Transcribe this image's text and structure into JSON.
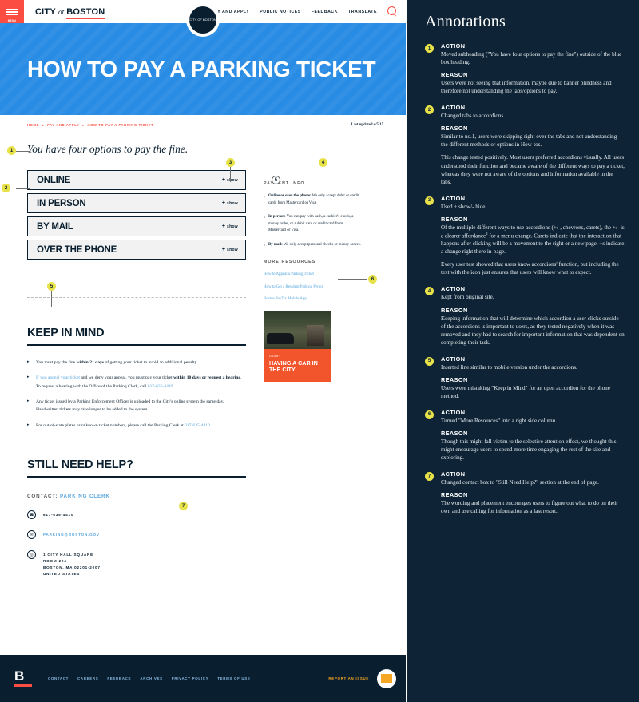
{
  "site": {
    "topbar": {
      "menu_label": "MENU",
      "logo_city": "CITY",
      "logo_of": "of",
      "logo_boston": "BOSTON",
      "seal_text": "CITY OF BOSTON",
      "nav": [
        "PAY AND APPLY",
        "PUBLIC NOTICES",
        "FEEDBACK",
        "TRANSLATE"
      ],
      "search_icon": "search-icon"
    },
    "hero_title": "HOW TO PAY A PARKING TICKET",
    "breadcrumbs": [
      "HOME",
      "PAY AND APPLY",
      "HOW TO PAY A PARKING TICKET"
    ],
    "breadcrumb_sep": "▸",
    "last_updated": "Last updated 4/5/15",
    "lede": "You have four options to pay the fine.",
    "accordions": [
      {
        "title": "ONLINE",
        "toggle": "show",
        "toggle_sign": "+"
      },
      {
        "title": "IN PERSON",
        "toggle": "show",
        "toggle_sign": "+"
      },
      {
        "title": "BY MAIL",
        "toggle": "show",
        "toggle_sign": "+"
      },
      {
        "title": "OVER THE PHONE",
        "toggle": "show",
        "toggle_sign": "+"
      }
    ],
    "payment_info": {
      "title": "PAYMENT INFO",
      "items": [
        {
          "lead": "Online or over the phone:",
          "text": " We only accept debit or credit cards from Mastercard or Visa."
        },
        {
          "lead": "In person:",
          "text": " You can pay with cash, a cashier's check, a money order, or a debit card or credit card from Mastercard or Visa."
        },
        {
          "lead": "By mail:",
          "text": " We only accept personal checks or money orders."
        }
      ]
    },
    "more_resources": {
      "title": "MORE RESOURCES",
      "links": [
        "How to Appeal a Parking Ticket",
        "How to Get a Resident Parking Permit",
        "Boston PayTix Mobile App"
      ]
    },
    "promo_card": {
      "eyebrow": "Guide:",
      "title": "HAVING A CAR IN THE CITY"
    },
    "keep_in_mind": {
      "heading": "KEEP IN MIND",
      "items": [
        {
          "a": "You must pay the fine ",
          "b": "within 21 days",
          "c": " of getting your ticket to avoid an additional penalty."
        },
        {
          "link1": "If you appeal your ticket",
          "a": " and we deny your appeal, you must pay your ticket ",
          "b": "within 10 days or request a hearing",
          "c": ". To request a hearing with the Office of the Parking Clerk, call ",
          "link2": "617-635-4410."
        },
        {
          "a": "Any ticket issued by a Parking Enforcement Officer is uploaded to the City's online system the same day. Handwritten tickets may take longer to be added to the system."
        },
        {
          "a": "For out-of-state plates or unknown ticket numbers, please call the Parking Clerk at ",
          "link2": "617-635-4410."
        }
      ]
    },
    "still_need_help": {
      "heading": "STILL NEED HELP?",
      "contact_label": "CONTACT:",
      "contact_link": "PARKING CLERK",
      "phone_icon": "phone-icon",
      "phone": "617-635-4410",
      "email_icon": "envelope-icon",
      "email": "PARKING@BOSTON.GOV",
      "location_icon": "map-pin-icon",
      "address": "1 CITY HALL SQUARE\nROOM 224\nBOSTON, MA 02201-2007\nUNITED STATES"
    },
    "footer": {
      "mark": "B",
      "links": [
        "CONTACT",
        "CAREERS",
        "FEEDBACK",
        "ARCHIVES",
        "PRIVACY POLICY",
        "TERMS OF USE"
      ],
      "report": "REPORT AN ISSUE"
    },
    "markers": [
      "1",
      "2",
      "3",
      "4",
      "5",
      "6",
      "7"
    ]
  },
  "annotations": {
    "title": "Annotations",
    "action_label": "ACTION",
    "reason_label": "REASON",
    "items": [
      {
        "num": "1",
        "action": "Moved subheading (\"You have four options to pay the fine\") outside of the blue box heading.",
        "reason": "Users were not seeing that information, maybe due to banner blindness and therefore not understanding the tabs/options to pay."
      },
      {
        "num": "2",
        "action": "Changed tabs to accordions.",
        "reason": "Similar to no.1, users were skipping right over the tabs and not understanding the different methods or options in How-tos.",
        "reason2": "This change tested positively. Most users preferred accordions visually. All users understood their function and became aware of the different ways to pay a ticket, whereas they were not aware of the options and information available in the tabs."
      },
      {
        "num": "3",
        "action": "Used + show/- hide.",
        "reason_a": "Of the multiple different ways to use accordions (+/-, chevrons, carets), the +/- is a clearer affordance",
        "reason_sup": "2",
        "reason_b": " for a menu change. Carets indicate that the interaction that happens after clicking will be a movement to the right or a new page. +s indicate a change right there in-page.",
        "reason2": "Every user test showed that users know accordions' function, but including the text with the icon just ensures that users will know what to expect."
      },
      {
        "num": "4",
        "action": "Kept from original site.",
        "reason": "Keeping information that will determine which accordion a user clicks outside of the accordions is important to users, as they tested negatively when it was removed and they had to search for important information that was dependent on completing their task."
      },
      {
        "num": "5",
        "action": "Inserted line similar to mobile version under the accordions.",
        "reason": "Users were mistaking \"Keep in Mind\" for an open accordion for the phone method."
      },
      {
        "num": "6",
        "action": "Turned \"More Resources\" into a right side column.",
        "reason": "Though this might fall victim to the selective attention effect, we thought this might encourage users to spend more time engaging the rest of the site and exploring."
      },
      {
        "num": "7",
        "action": "Changed contact box to \"Still Need Help?\" section at the end of page.",
        "reason": "The wording and placement encourages users to figure out what to do on their own and use calling for information as a last resort."
      }
    ]
  },
  "colors": {
    "brand_blue": "#288be4",
    "navy": "#091f2f",
    "red": "#fb4d42",
    "marker_yellow": "#e8e24a",
    "link_blue": "#58a6dd",
    "panel_bg": "#0e2436",
    "card_red": "#f2552c",
    "footer_gold": "#f5a623"
  }
}
